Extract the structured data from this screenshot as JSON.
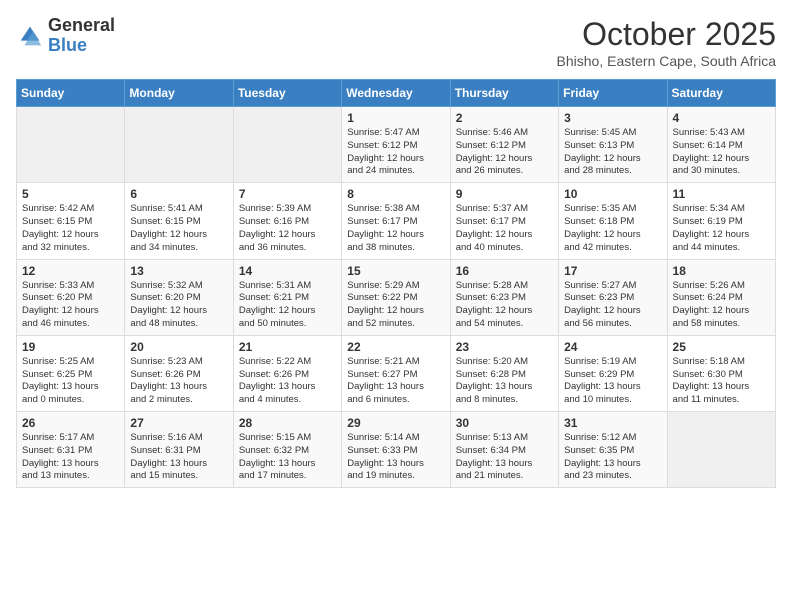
{
  "logo": {
    "general": "General",
    "blue": "Blue"
  },
  "title": "October 2025",
  "subtitle": "Bhisho, Eastern Cape, South Africa",
  "days_of_week": [
    "Sunday",
    "Monday",
    "Tuesday",
    "Wednesday",
    "Thursday",
    "Friday",
    "Saturday"
  ],
  "weeks": [
    [
      {
        "day": "",
        "content": ""
      },
      {
        "day": "",
        "content": ""
      },
      {
        "day": "",
        "content": ""
      },
      {
        "day": "1",
        "content": "Sunrise: 5:47 AM\nSunset: 6:12 PM\nDaylight: 12 hours\nand 24 minutes."
      },
      {
        "day": "2",
        "content": "Sunrise: 5:46 AM\nSunset: 6:12 PM\nDaylight: 12 hours\nand 26 minutes."
      },
      {
        "day": "3",
        "content": "Sunrise: 5:45 AM\nSunset: 6:13 PM\nDaylight: 12 hours\nand 28 minutes."
      },
      {
        "day": "4",
        "content": "Sunrise: 5:43 AM\nSunset: 6:14 PM\nDaylight: 12 hours\nand 30 minutes."
      }
    ],
    [
      {
        "day": "5",
        "content": "Sunrise: 5:42 AM\nSunset: 6:15 PM\nDaylight: 12 hours\nand 32 minutes."
      },
      {
        "day": "6",
        "content": "Sunrise: 5:41 AM\nSunset: 6:15 PM\nDaylight: 12 hours\nand 34 minutes."
      },
      {
        "day": "7",
        "content": "Sunrise: 5:39 AM\nSunset: 6:16 PM\nDaylight: 12 hours\nand 36 minutes."
      },
      {
        "day": "8",
        "content": "Sunrise: 5:38 AM\nSunset: 6:17 PM\nDaylight: 12 hours\nand 38 minutes."
      },
      {
        "day": "9",
        "content": "Sunrise: 5:37 AM\nSunset: 6:17 PM\nDaylight: 12 hours\nand 40 minutes."
      },
      {
        "day": "10",
        "content": "Sunrise: 5:35 AM\nSunset: 6:18 PM\nDaylight: 12 hours\nand 42 minutes."
      },
      {
        "day": "11",
        "content": "Sunrise: 5:34 AM\nSunset: 6:19 PM\nDaylight: 12 hours\nand 44 minutes."
      }
    ],
    [
      {
        "day": "12",
        "content": "Sunrise: 5:33 AM\nSunset: 6:20 PM\nDaylight: 12 hours\nand 46 minutes."
      },
      {
        "day": "13",
        "content": "Sunrise: 5:32 AM\nSunset: 6:20 PM\nDaylight: 12 hours\nand 48 minutes."
      },
      {
        "day": "14",
        "content": "Sunrise: 5:31 AM\nSunset: 6:21 PM\nDaylight: 12 hours\nand 50 minutes."
      },
      {
        "day": "15",
        "content": "Sunrise: 5:29 AM\nSunset: 6:22 PM\nDaylight: 12 hours\nand 52 minutes."
      },
      {
        "day": "16",
        "content": "Sunrise: 5:28 AM\nSunset: 6:23 PM\nDaylight: 12 hours\nand 54 minutes."
      },
      {
        "day": "17",
        "content": "Sunrise: 5:27 AM\nSunset: 6:23 PM\nDaylight: 12 hours\nand 56 minutes."
      },
      {
        "day": "18",
        "content": "Sunrise: 5:26 AM\nSunset: 6:24 PM\nDaylight: 12 hours\nand 58 minutes."
      }
    ],
    [
      {
        "day": "19",
        "content": "Sunrise: 5:25 AM\nSunset: 6:25 PM\nDaylight: 13 hours\nand 0 minutes."
      },
      {
        "day": "20",
        "content": "Sunrise: 5:23 AM\nSunset: 6:26 PM\nDaylight: 13 hours\nand 2 minutes."
      },
      {
        "day": "21",
        "content": "Sunrise: 5:22 AM\nSunset: 6:26 PM\nDaylight: 13 hours\nand 4 minutes."
      },
      {
        "day": "22",
        "content": "Sunrise: 5:21 AM\nSunset: 6:27 PM\nDaylight: 13 hours\nand 6 minutes."
      },
      {
        "day": "23",
        "content": "Sunrise: 5:20 AM\nSunset: 6:28 PM\nDaylight: 13 hours\nand 8 minutes."
      },
      {
        "day": "24",
        "content": "Sunrise: 5:19 AM\nSunset: 6:29 PM\nDaylight: 13 hours\nand 10 minutes."
      },
      {
        "day": "25",
        "content": "Sunrise: 5:18 AM\nSunset: 6:30 PM\nDaylight: 13 hours\nand 11 minutes."
      }
    ],
    [
      {
        "day": "26",
        "content": "Sunrise: 5:17 AM\nSunset: 6:31 PM\nDaylight: 13 hours\nand 13 minutes."
      },
      {
        "day": "27",
        "content": "Sunrise: 5:16 AM\nSunset: 6:31 PM\nDaylight: 13 hours\nand 15 minutes."
      },
      {
        "day": "28",
        "content": "Sunrise: 5:15 AM\nSunset: 6:32 PM\nDaylight: 13 hours\nand 17 minutes."
      },
      {
        "day": "29",
        "content": "Sunrise: 5:14 AM\nSunset: 6:33 PM\nDaylight: 13 hours\nand 19 minutes."
      },
      {
        "day": "30",
        "content": "Sunrise: 5:13 AM\nSunset: 6:34 PM\nDaylight: 13 hours\nand 21 minutes."
      },
      {
        "day": "31",
        "content": "Sunrise: 5:12 AM\nSunset: 6:35 PM\nDaylight: 13 hours\nand 23 minutes."
      },
      {
        "day": "",
        "content": ""
      }
    ]
  ]
}
